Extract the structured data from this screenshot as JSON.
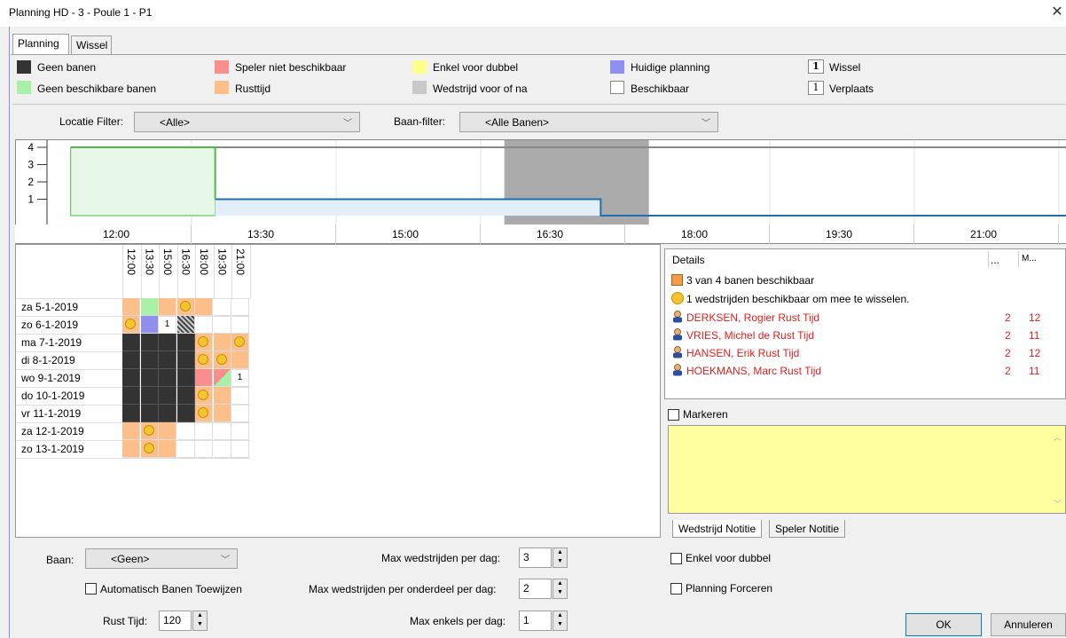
{
  "window": {
    "title": "Planning HD - 3 - Poule 1 - P1",
    "close": "✕"
  },
  "tabs": [
    {
      "label": "Planning",
      "active": true
    },
    {
      "label": "Wissel",
      "active": false
    }
  ],
  "legend": {
    "items": [
      {
        "label": "Geen banen",
        "color": "#333333"
      },
      {
        "label": "Geen beschikbare banen",
        "color": "#a8f0a8"
      },
      {
        "label": "Speler niet beschikbaar",
        "color": "#f88e8e"
      },
      {
        "label": "Rusttijd",
        "color": "#fcbf8a"
      },
      {
        "label": "Enkel voor dubbel",
        "color": "#ffff8a"
      },
      {
        "label": "Wedstrijd voor of na",
        "color": "#c8c8c8"
      },
      {
        "label": "Huidige planning",
        "color": "#8f8fef"
      },
      {
        "label": "Beschikbaar",
        "color": "#ffffff"
      }
    ],
    "wissel": {
      "count": "1",
      "label": "Wissel"
    },
    "verplaats": {
      "count": "1",
      "label": "Verplaats"
    }
  },
  "filters": {
    "locatie_label": "Locatie Filter:",
    "locatie_value": "<Alle>",
    "baan_label": "Baan-filter:",
    "baan_value": "<Alle Banen>"
  },
  "chart_data": {
    "type": "area",
    "y_ticks": [
      "4",
      "3",
      "2",
      "1"
    ],
    "ylim": [
      0,
      4
    ],
    "x_ticks": [
      "12:00",
      "13:30",
      "15:00",
      "16:30",
      "18:00",
      "19:30",
      "21:00"
    ],
    "series": [
      {
        "values_description": "available courts",
        "x": [
          "11:30",
          "13:00",
          "13:00",
          "17:00",
          "17:00",
          "21:45"
        ],
        "y": [
          4,
          4,
          1,
          1,
          0,
          0
        ]
      }
    ],
    "gray_band": [
      "16:00",
      "17:30"
    ]
  },
  "grid": {
    "times": [
      "12:00",
      "13:30",
      "15:00",
      "16:30",
      "18:00",
      "19:30",
      "21:00"
    ],
    "dates": [
      "za 5-1-2019",
      "zo 6-1-2019",
      "ma 7-1-2019",
      "di 8-1-2019",
      "wo 9-1-2019",
      "do 10-1-2019",
      "vr 11-1-2019",
      "za 12-1-2019",
      "zo 13-1-2019"
    ],
    "rows": [
      [
        "o",
        "g",
        "o",
        "oc",
        "o",
        "",
        ""
      ],
      [
        "oc",
        "b",
        "1",
        "hatch",
        "",
        "",
        ""
      ],
      [
        "d",
        "d",
        "d",
        "d",
        "oc",
        "o",
        "oc"
      ],
      [
        "d",
        "d",
        "d",
        "d",
        "oc",
        "oc",
        "o"
      ],
      [
        "d",
        "d",
        "d",
        "d",
        "r",
        "rg",
        "1"
      ],
      [
        "d",
        "d",
        "d",
        "d",
        "oc",
        "o",
        ""
      ],
      [
        "d",
        "d",
        "d",
        "d",
        "oc",
        "o",
        ""
      ],
      [
        "o",
        "oc",
        "o",
        "",
        "",
        "",
        ""
      ],
      [
        "o",
        "oc",
        "o",
        "",
        "",
        "",
        ""
      ]
    ],
    "cell_texts": {
      "one": "1"
    }
  },
  "details": {
    "header": "Details",
    "col1": "...",
    "col2": "M...",
    "banen": "3 van 4 banen beschikbaar",
    "wissel_info": "1 wedstrijden beschikbaar om mee te wisselen.",
    "players": [
      {
        "name": "DERKSEN, Rogier Rust Tijd",
        "a": "2",
        "b": "12"
      },
      {
        "name": "VRIES, Michel de Rust Tijd",
        "a": "2",
        "b": "11"
      },
      {
        "name": "HANSEN, Erik Rust Tijd",
        "a": "2",
        "b": "12"
      },
      {
        "name": "HOEKMANS, Marc Rust Tijd",
        "a": "2",
        "b": "11"
      }
    ]
  },
  "notes": {
    "markeren": "Markeren",
    "tab_wedstrijd": "Wedstrijd Notitie",
    "tab_speler": "Speler Notitie"
  },
  "bottom": {
    "baan_label": "Baan:",
    "baan_value": "<Geen>",
    "auto_label": "Automatisch Banen Toewijzen",
    "rust_label": "Rust Tijd:",
    "rust_value": "120",
    "max_dag_label": "Max wedstrijden per dag:",
    "max_dag_value": "3",
    "max_onderdeel_label": "Max wedstrijden per onderdeel per dag:",
    "max_onderdeel_value": "2",
    "max_enkels_label": "Max enkels per dag:",
    "max_enkels_value": "1",
    "enkel_dubbel_label": "Enkel voor dubbel",
    "forceren_label": "Planning Forceren",
    "ok": "OK",
    "annuleren": "Annuleren"
  }
}
